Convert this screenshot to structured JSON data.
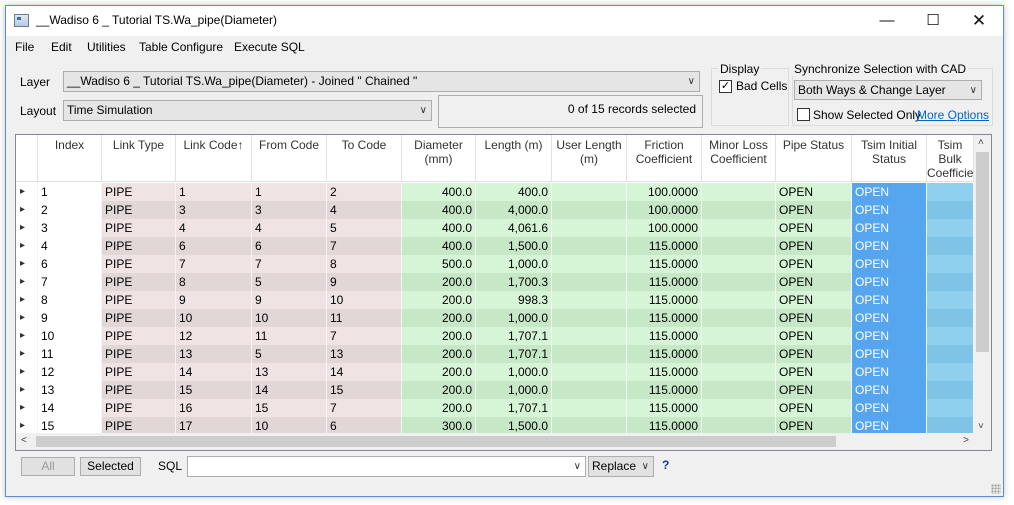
{
  "window": {
    "title": "__Wadiso 6 _ Tutorial TS.Wa_pipe(Diameter)"
  },
  "menu": [
    "File",
    "Edit",
    "Utilities",
    "Table Configure",
    "Execute SQL"
  ],
  "layer": {
    "label": "Layer",
    "value": "__Wadiso 6 _ Tutorial TS.Wa_pipe(Diameter) - Joined \" Chained \""
  },
  "layout": {
    "label": "Layout",
    "value": "Time Simulation"
  },
  "records": "0 of 15 records selected",
  "display": {
    "title": "Display",
    "bad_cells_label": "Bad Cells",
    "bad_cells_checked": true
  },
  "sync": {
    "title": "Synchronize Selection with CAD",
    "value": "Both Ways & Change Layer",
    "show_selected_label": "Show Selected Only",
    "show_selected_checked": false,
    "more_options": "More Options"
  },
  "table": {
    "columns": [
      "Index",
      "Link Type",
      "Link Code",
      "From Code",
      "To Code",
      "Diameter\n(mm)",
      "Length (m)",
      "User Length\n(m)",
      "Friction\nCoefficient",
      "Minor Loss\nCoefficient",
      "Pipe Status",
      "Tsim Initial\nStatus",
      "Tsim Bulk\nCoefficie"
    ],
    "sort_icon": "sort-ascending-arrow",
    "rows": [
      [
        "1",
        "PIPE",
        "1",
        "1",
        "2",
        "400.0",
        "400.0",
        "",
        "100.0000",
        "",
        "OPEN",
        "OPEN",
        ""
      ],
      [
        "2",
        "PIPE",
        "3",
        "3",
        "4",
        "400.0",
        "4,000.0",
        "",
        "100.0000",
        "",
        "OPEN",
        "OPEN",
        ""
      ],
      [
        "3",
        "PIPE",
        "4",
        "4",
        "5",
        "400.0",
        "4,061.6",
        "",
        "100.0000",
        "",
        "OPEN",
        "OPEN",
        ""
      ],
      [
        "4",
        "PIPE",
        "6",
        "6",
        "7",
        "400.0",
        "1,500.0",
        "",
        "115.0000",
        "",
        "OPEN",
        "OPEN",
        ""
      ],
      [
        "6",
        "PIPE",
        "7",
        "7",
        "8",
        "500.0",
        "1,000.0",
        "",
        "115.0000",
        "",
        "OPEN",
        "OPEN",
        ""
      ],
      [
        "7",
        "PIPE",
        "8",
        "5",
        "9",
        "200.0",
        "1,700.3",
        "",
        "115.0000",
        "",
        "OPEN",
        "OPEN",
        ""
      ],
      [
        "8",
        "PIPE",
        "9",
        "9",
        "10",
        "200.0",
        "998.3",
        "",
        "115.0000",
        "",
        "OPEN",
        "OPEN",
        ""
      ],
      [
        "9",
        "PIPE",
        "10",
        "10",
        "11",
        "200.0",
        "1,000.0",
        "",
        "115.0000",
        "",
        "OPEN",
        "OPEN",
        ""
      ],
      [
        "10",
        "PIPE",
        "12",
        "11",
        "7",
        "200.0",
        "1,707.1",
        "",
        "115.0000",
        "",
        "OPEN",
        "OPEN",
        ""
      ],
      [
        "11",
        "PIPE",
        "13",
        "5",
        "13",
        "200.0",
        "1,707.1",
        "",
        "115.0000",
        "",
        "OPEN",
        "OPEN",
        ""
      ],
      [
        "12",
        "PIPE",
        "14",
        "13",
        "14",
        "200.0",
        "1,000.0",
        "",
        "115.0000",
        "",
        "OPEN",
        "OPEN",
        ""
      ],
      [
        "13",
        "PIPE",
        "15",
        "14",
        "15",
        "200.0",
        "1,000.0",
        "",
        "115.0000",
        "",
        "OPEN",
        "OPEN",
        ""
      ],
      [
        "14",
        "PIPE",
        "16",
        "15",
        "7",
        "200.0",
        "1,707.1",
        "",
        "115.0000",
        "",
        "OPEN",
        "OPEN",
        ""
      ],
      [
        "15",
        "PIPE",
        "17",
        "10",
        "6",
        "300.0",
        "1,500.0",
        "",
        "115.0000",
        "",
        "OPEN",
        "OPEN",
        ""
      ]
    ]
  },
  "bottom": {
    "all": "All",
    "selected": "Selected",
    "sql_label": "SQL",
    "sql_value": "",
    "replace": "Replace",
    "help": "?"
  }
}
